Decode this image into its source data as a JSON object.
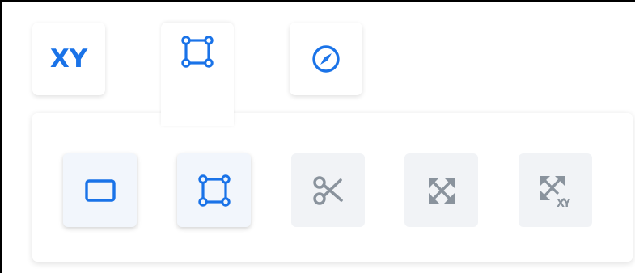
{
  "tabs": [
    {
      "name": "xy-tab",
      "label": "XY",
      "icon": "xy-text-icon"
    },
    {
      "name": "edit-shape-tab",
      "icon": "polygon-vertex-icon",
      "selected": true
    },
    {
      "name": "compass-tab",
      "icon": "compass-icon"
    }
  ],
  "tools": [
    {
      "name": "rectangle-tool",
      "icon": "rectangle-icon",
      "state": "active"
    },
    {
      "name": "vertex-edit-tool",
      "icon": "polygon-vertex-icon",
      "state": "active"
    },
    {
      "name": "cut-tool",
      "icon": "scissors-icon",
      "state": "disabled"
    },
    {
      "name": "expand-tool",
      "icon": "expand-arrows-icon",
      "state": "disabled"
    },
    {
      "name": "expand-xy-tool",
      "icon": "expand-arrows-xy-icon",
      "badge": "X-Y",
      "state": "disabled"
    }
  ],
  "colors": {
    "accent": "#1a73e8",
    "disabled_icon": "#8a939d",
    "active_bg": "#f2f6fc",
    "disabled_bg": "#f1f3f6"
  }
}
